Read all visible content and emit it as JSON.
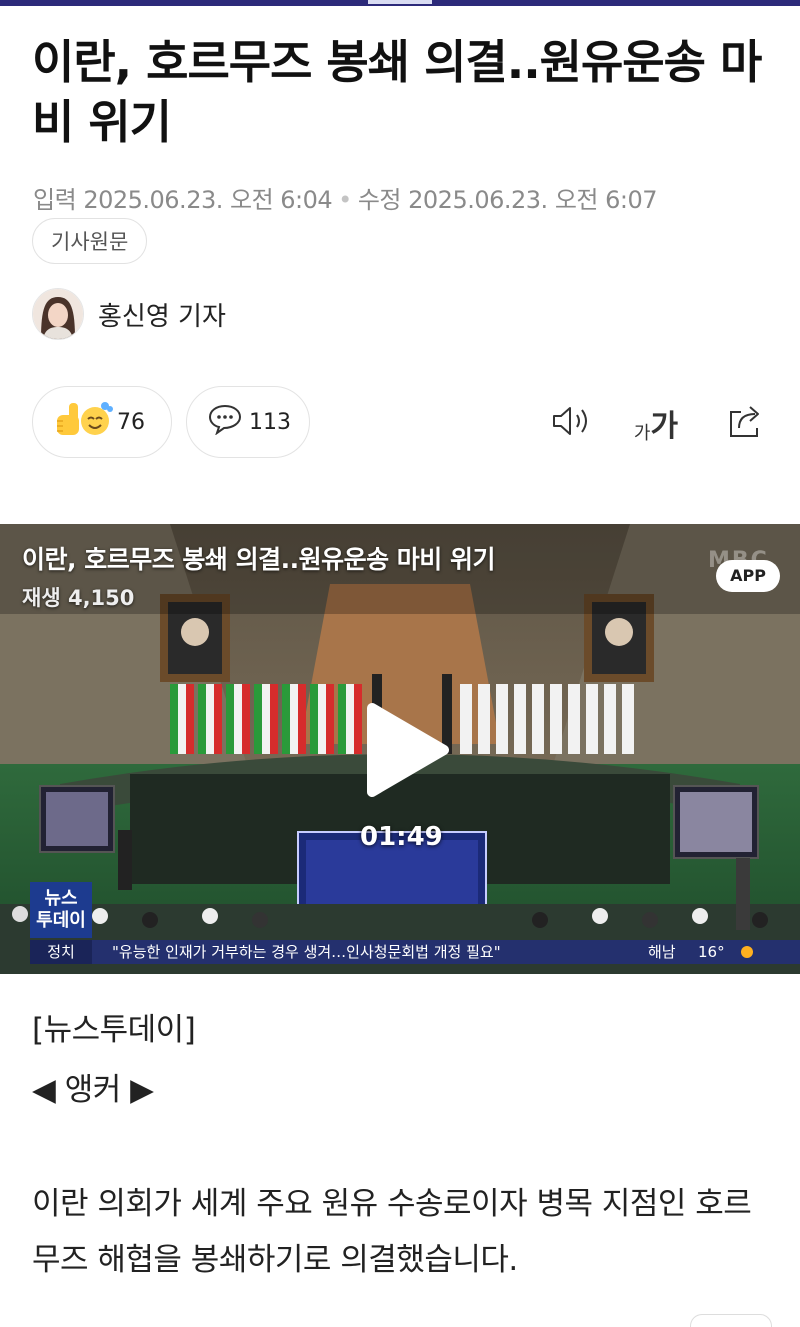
{
  "article": {
    "title": "이란, 호르무즈 봉쇄 의결..원유운송 마비 위기",
    "meta": {
      "input_label": "입력",
      "input_time": "2025.06.23. 오전 6:04",
      "edit_label": "수정",
      "edit_time": "2025.06.23. 오전 6:07"
    },
    "original_button": "기사원문",
    "author": "홍신영 기자"
  },
  "actions": {
    "reaction_count": "76",
    "comment_count": "113",
    "font_size_label_small": "가",
    "font_size_label_large": "가"
  },
  "video": {
    "title": "이란, 호르무즈 봉쇄 의결..원유운송 마비 위기",
    "play_count": "재생 4,150",
    "app_badge": "APP",
    "broadcaster_watermark": "MBC",
    "duration": "01:49",
    "program_logo_line1": "뉴스",
    "program_logo_line2": "투데이",
    "ticker_category": "정치",
    "ticker_text": "\"유능한 인재가 거부하는 경우 생겨…인사청문회법 개정 필요\"",
    "ticker_region": "해남",
    "ticker_temp": "16°"
  },
  "body": {
    "program": "[뉴스투데이]",
    "anchor": "◀ 앵커 ▶",
    "paragraph1": "이란 의회가 세계 주요 원유 수송로이자 병목 지점인 호르무즈 해협을 봉쇄하기로 의결했습니다."
  },
  "colors": {
    "top_bar": "#2c2a7a",
    "text_primary": "#111111",
    "text_meta": "#8a8a8a",
    "border": "#e3e3e3"
  },
  "icons": [
    "thumbs-up-emoji-icon",
    "hug-emoji-icon",
    "comment-icon",
    "speaker-icon",
    "font-size-icon",
    "share-icon",
    "play-icon"
  ]
}
